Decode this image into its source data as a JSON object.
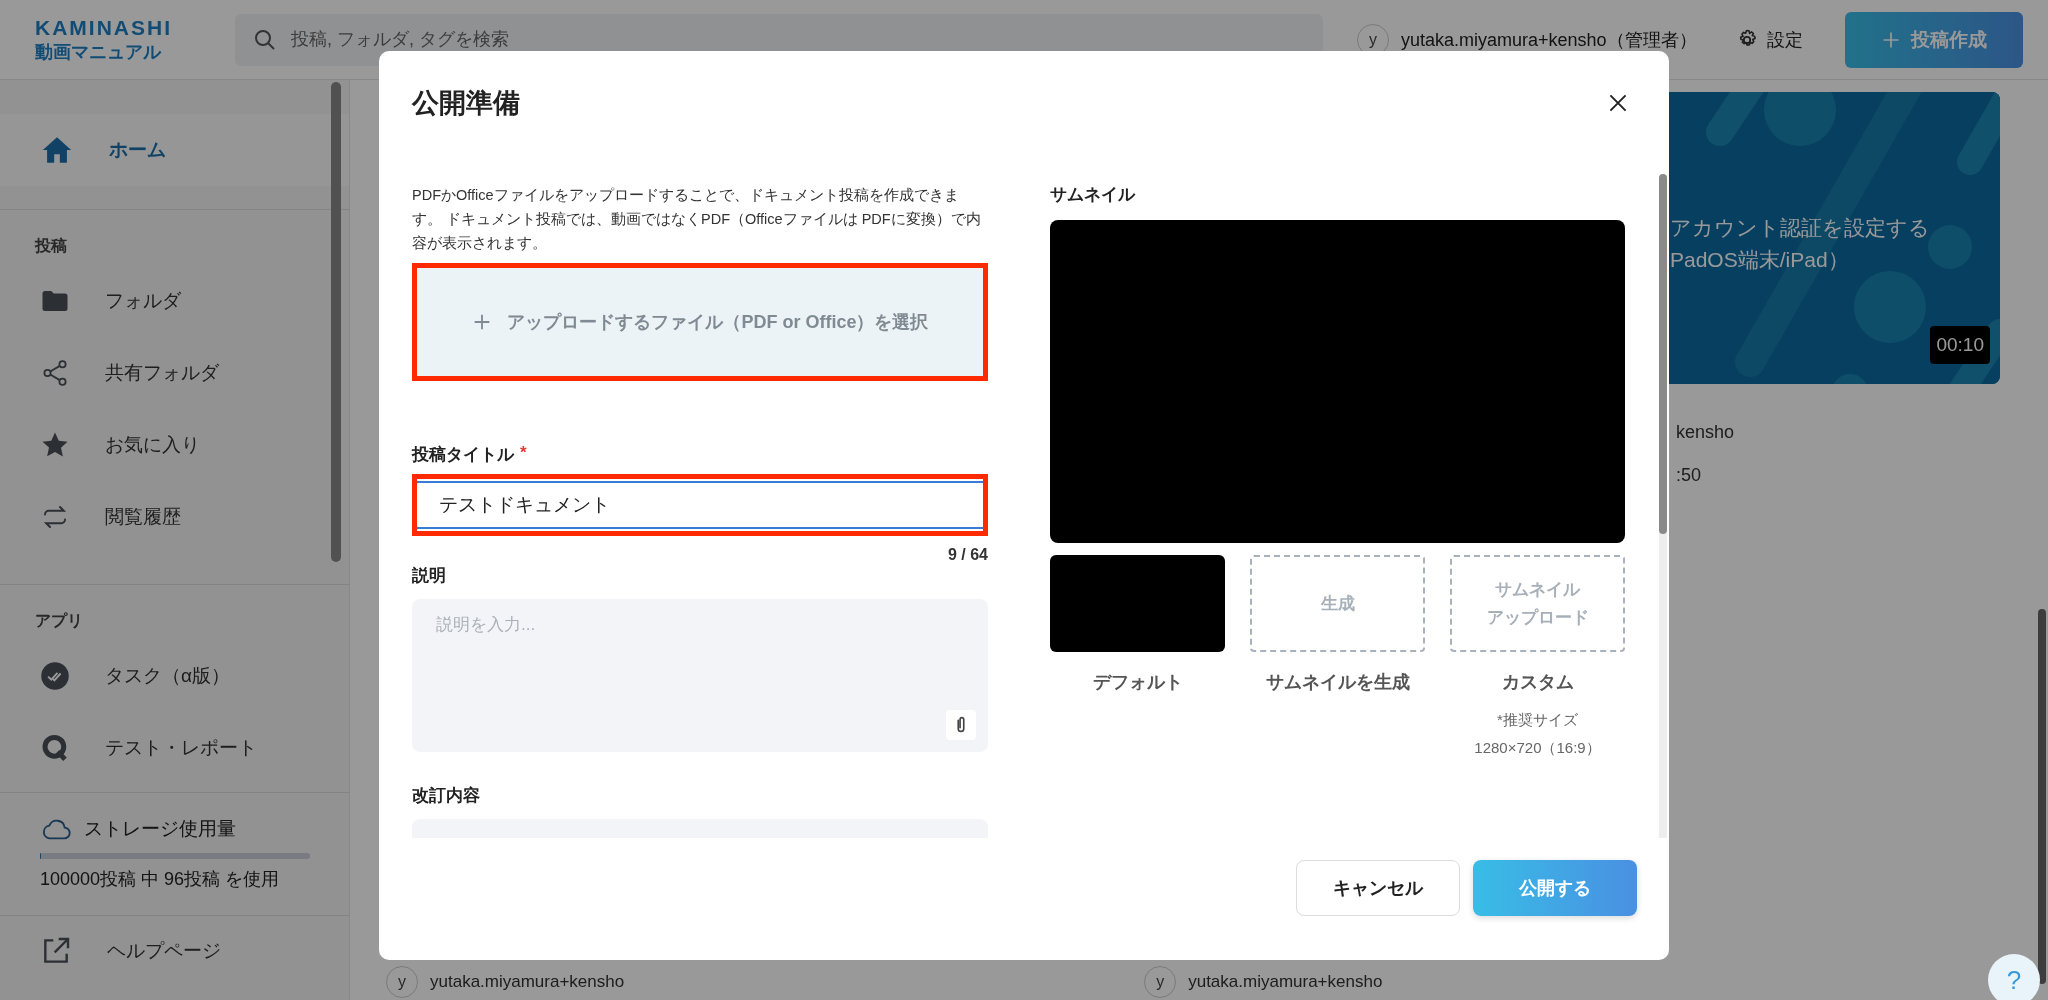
{
  "header": {
    "logo": {
      "brand": "KAMINASHI",
      "product": "動画マニュアル"
    },
    "search": {
      "placeholder": "投稿, フォルダ, タグを検索"
    },
    "user": {
      "initial": "y",
      "name": "yutaka.miyamura+kensho（管理者）"
    },
    "settings": "設定",
    "create_button": "投稿作成"
  },
  "sidebar": {
    "home": {
      "label": "ホーム",
      "selected": true
    },
    "sections": [
      {
        "heading": "投稿",
        "items": [
          {
            "label": "フォルダ",
            "selected": false
          },
          {
            "label": "共有フォルダ",
            "selected": false
          },
          {
            "label": "お気に入り",
            "selected": false
          },
          {
            "label": "閲覧履歴",
            "selected": false
          }
        ]
      },
      {
        "heading": "アプリ",
        "items": [
          {
            "label": "タスク（α版）",
            "selected": false
          },
          {
            "label": "テスト・レポート",
            "selected": false
          }
        ]
      }
    ],
    "storage": {
      "label": "ストレージ使用量",
      "level": 0.001,
      "usage": "100000投稿 中 96投稿 を使用"
    },
    "help": {
      "label": "ヘルプページ"
    }
  },
  "background": {
    "card": {
      "title_lines": [
        "アカウント認証を設定する",
        "PadOS端末/iPad）"
      ],
      "duration": "00:10",
      "author": "kensho",
      "date": ":50"
    },
    "authors": [
      {
        "initial": "y",
        "name": "yutaka.miyamura+kensho"
      },
      {
        "initial": "y",
        "name": "yutaka.miyamura+kensho"
      }
    ]
  },
  "dialog": {
    "title": "公開準備",
    "intro": "PDFかOfficeファイルをアップロードすることで、ドキュメント投稿を作成できます。 ドキュメント投稿では、動画ではなくPDF（Officeファイルは PDFに変換）で内容が表示されます。",
    "upload": {
      "label": "アップロードするファイル（PDF or Office）を選択",
      "highlighted": true
    },
    "title_field": {
      "label": "投稿タイトル",
      "required_mark": "*",
      "value": "テストドキュメント",
      "counter": "9 / 64",
      "highlighted": true
    },
    "description": {
      "label": "説明",
      "placeholder": "説明を入力..."
    },
    "revision": {
      "label": "改訂内容"
    },
    "thumbnail": {
      "label": "サムネイル",
      "options": [
        {
          "caption": "デフォルト"
        },
        {
          "kind": "button",
          "button_lines": [
            "生成"
          ],
          "caption": "サムネイルを生成"
        },
        {
          "kind": "button",
          "button_lines": [
            "サムネイル",
            "アップロード"
          ],
          "caption": "カスタム",
          "note_lines": [
            "*推奨サイズ",
            "1280×720（16:9）"
          ]
        }
      ]
    },
    "buttons": [
      {
        "label": "キャンセル",
        "kind": "secondary"
      },
      {
        "label": "公開する",
        "kind": "primary"
      }
    ]
  },
  "help_button": "?"
}
